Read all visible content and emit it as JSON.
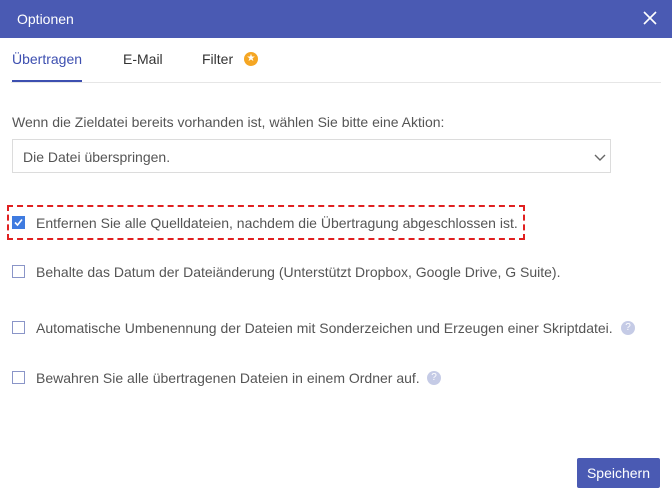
{
  "window": {
    "title": "Optionen",
    "close_icon": "close-icon"
  },
  "tabs": [
    {
      "label": "Übertragen",
      "active": true
    },
    {
      "label": "E-Mail",
      "active": false
    },
    {
      "label": "Filter",
      "active": false,
      "badge_icon": "star-icon",
      "badge_color": "#f5a623"
    }
  ],
  "action": {
    "prompt": "Wenn die Zieldatei bereits vorhanden ist, wählen Sie bitte eine Aktion:",
    "selected": "Die Datei überspringen."
  },
  "options": [
    {
      "label": "Entfernen Sie alle Quelldateien, nachdem die Übertragung abgeschlossen ist.",
      "checked": true,
      "highlighted": true
    },
    {
      "label": "Behalte das Datum der Dateiänderung (Unterstützt Dropbox, Google Drive, G Suite).",
      "checked": false
    },
    {
      "label": "Automatische Umbenennung der Dateien mit Sonderzeichen und Erzeugen einer Skriptdatei.",
      "checked": false,
      "help_icon": "help-icon"
    },
    {
      "label": "Bewahren Sie alle übertragenen Dateien in einem Ordner auf.",
      "checked": false,
      "help_icon": "help-icon"
    }
  ],
  "footer": {
    "save_label": "Speichern"
  },
  "colors": {
    "accent": "#4a5ab3",
    "checkbox_checked": "#3f7be0",
    "highlight": "#e02020"
  }
}
